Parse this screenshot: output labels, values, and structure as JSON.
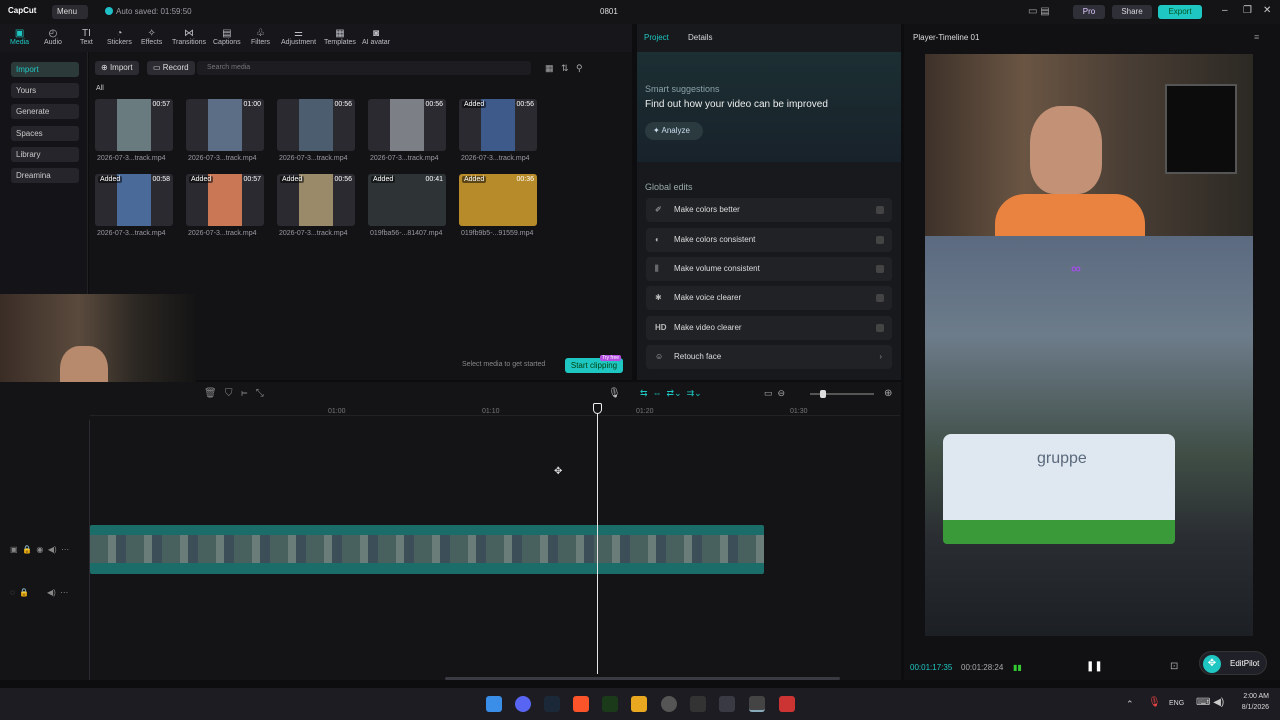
{
  "titlebar": {
    "logo": "CapCut",
    "menu": "Menu",
    "autosave": "Auto saved: 01:59:50",
    "title": "0801",
    "pro": "Pro",
    "share": "Share",
    "export": "Export"
  },
  "toolbar": {
    "tools": [
      {
        "label": "Media",
        "icon": "media-icon"
      },
      {
        "label": "Audio",
        "icon": "audio-icon"
      },
      {
        "label": "Text",
        "icon": "text-icon"
      },
      {
        "label": "Stickers",
        "icon": "stickers-icon"
      },
      {
        "label": "Effects",
        "icon": "effects-icon"
      },
      {
        "label": "Transitions",
        "icon": "transitions-icon"
      },
      {
        "label": "Captions",
        "icon": "captions-icon"
      },
      {
        "label": "Filters",
        "icon": "filters-icon"
      },
      {
        "label": "Adjustment",
        "icon": "adjustment-icon"
      },
      {
        "label": "Templates",
        "icon": "templates-icon"
      },
      {
        "label": "AI avatar",
        "icon": "ai-avatar-icon"
      }
    ]
  },
  "sidebar": {
    "items": [
      {
        "label": "Import"
      },
      {
        "label": "Yours"
      },
      {
        "label": "Generate"
      },
      {
        "label": "Spaces"
      },
      {
        "label": "Library"
      },
      {
        "label": "Dreamina"
      }
    ]
  },
  "media": {
    "import": "Import",
    "record": "Record",
    "search_placeholder": "Search media",
    "all": "All",
    "items": [
      {
        "name": "2026-07-3...track.mp4",
        "duration": "00:57",
        "added": ""
      },
      {
        "name": "2026-07-3...track.mp4",
        "duration": "01:00",
        "added": ""
      },
      {
        "name": "2026-07-3...track.mp4",
        "duration": "00:56",
        "added": ""
      },
      {
        "name": "2026-07-3...track.mp4",
        "duration": "00:56",
        "added": ""
      },
      {
        "name": "2026-07-3...track.mp4",
        "duration": "00:56",
        "added": "Added"
      },
      {
        "name": "2026-07-3...track.mp4",
        "duration": "00:58",
        "added": "Added"
      },
      {
        "name": "2026-07-3...track.mp4",
        "duration": "00:57",
        "added": "Added"
      },
      {
        "name": "2026-07-3...track.mp4",
        "duration": "00:56",
        "added": "Added"
      },
      {
        "name": "019fba56-...81407.mp4",
        "duration": "00:41",
        "added": "Added"
      },
      {
        "name": "019fb9b5-...91559.mp4",
        "duration": "00:36",
        "added": "Added"
      }
    ],
    "hint": "Select media to get started",
    "start_clipping": "Start clipping",
    "try_free": "Try free"
  },
  "right_panel": {
    "tabs": [
      "Project",
      "Details"
    ],
    "smart_title": "Smart suggestions",
    "smart_sub": "Find out how your video can be improved",
    "analyze": "Analyze",
    "global_edits": "Global edits",
    "edits": [
      {
        "label": "Make colors better",
        "icon": "wand-icon"
      },
      {
        "label": "Make colors consistent",
        "icon": "palette-icon"
      },
      {
        "label": "Make volume consistent",
        "icon": "sliders-icon"
      },
      {
        "label": "Make voice clearer",
        "icon": "voice-icon"
      },
      {
        "label": "Make video clearer",
        "icon": "hd-icon"
      },
      {
        "label": "Retouch face",
        "icon": "face-icon"
      }
    ]
  },
  "player": {
    "title": "Player-Timeline 01",
    "current": "00:01:17:35",
    "total": "00:01:28:24",
    "truck_text": "gruppe",
    "extension": "EditPilot"
  },
  "timeline": {
    "ruler": [
      "01:00",
      "01:10",
      "01:20",
      "01:30"
    ]
  },
  "taskbar": {
    "lang": "ENG",
    "time": "2:00 AM",
    "date": "8/1/2026"
  }
}
